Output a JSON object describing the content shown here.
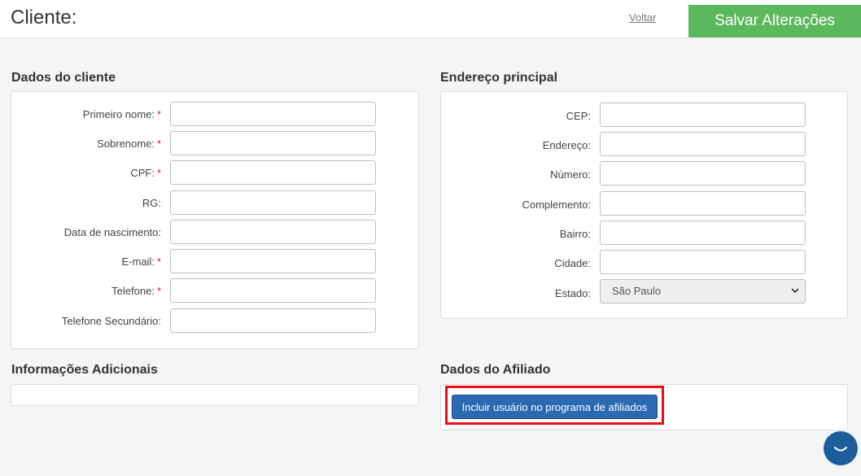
{
  "header": {
    "title": "Cliente:",
    "back_label": "Voltar",
    "save_label": "Salvar Alterações"
  },
  "client_section": {
    "title": "Dados do cliente",
    "fields": [
      {
        "label": "Primeiro nome:",
        "required": "*",
        "value": ""
      },
      {
        "label": "Sobrenome:",
        "required": "*",
        "value": ""
      },
      {
        "label": "CPF:",
        "required": "*",
        "value": ""
      },
      {
        "label": "RG:",
        "required": "",
        "value": ""
      },
      {
        "label": "Data de nascimento:",
        "required": "",
        "value": ""
      },
      {
        "label": "E-mail:",
        "required": "*",
        "value": ""
      },
      {
        "label": "Telefone:",
        "required": "*",
        "value": ""
      },
      {
        "label": "Telefone Secundário:",
        "required": "",
        "value": ""
      }
    ]
  },
  "address_section": {
    "title": "Endereço principal",
    "fields": [
      {
        "label": "CEP:",
        "value": ""
      },
      {
        "label": "Endereço:",
        "value": ""
      },
      {
        "label": "Número:",
        "value": ""
      },
      {
        "label": "Complemento:",
        "value": ""
      },
      {
        "label": "Bairro:",
        "value": ""
      },
      {
        "label": "Cidade:",
        "value": ""
      }
    ],
    "state_label": "Estado:",
    "state_value": "São Paulo"
  },
  "additional_section": {
    "title": "Informações Adicionais"
  },
  "affiliate_section": {
    "title": "Dados do Afiliado",
    "button_label": "Incluir usuário no programa de afiliados"
  },
  "colors": {
    "save_button": "#5cb85c",
    "primary_button": "#2a6ab3",
    "highlight": "#e8101b",
    "required": "#d9231d",
    "chat_button": "#1e5d9c"
  },
  "icons": {
    "select": "chevron-down-icon",
    "chat": "chat-icon"
  }
}
